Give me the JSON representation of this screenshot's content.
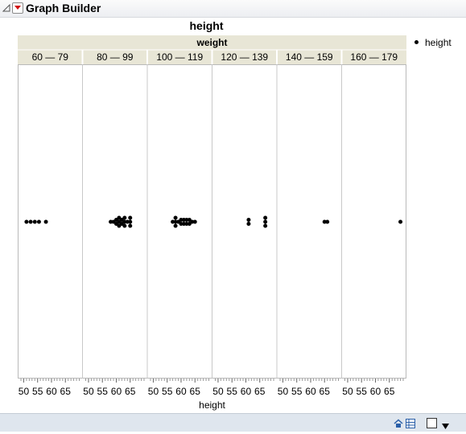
{
  "app": {
    "title": "Graph Builder"
  },
  "graph": {
    "title": "height",
    "legend": [
      {
        "label": "height",
        "marker": "filled-circle"
      }
    ]
  },
  "chart_data": {
    "type": "scatter",
    "title": "height",
    "xlabel": "height",
    "ylabel": "",
    "facet_title": "weight",
    "facets": [
      "60 — 79",
      "80 — 99",
      "100 — 119",
      "120 — 139",
      "140 — 159",
      "160 — 179"
    ],
    "xlim": [
      49,
      70
    ],
    "xticks": [
      50,
      55,
      60,
      65
    ],
    "grid": false,
    "legend_position": "right",
    "series": [
      {
        "name": "height",
        "panels": [
          {
            "x": [
              51,
              52.5,
              54,
              55.5,
              58
            ],
            "y": [
              0,
              0,
              0,
              0,
              0
            ]
          },
          {
            "x": [
              58,
              59,
              60,
              60,
              61,
              61,
              61,
              62,
              62,
              63,
              63,
              63,
              64,
              65,
              65,
              65
            ],
            "y": [
              0,
              0,
              0,
              0,
              0,
              0,
              0,
              0,
              0,
              0,
              0,
              0,
              0,
              0,
              0,
              0
            ]
          },
          {
            "x": [
              57,
              58,
              58,
              58,
              59,
              60,
              60,
              61,
              61,
              62,
              62,
              63,
              63,
              64,
              65
            ],
            "y": [
              0,
              0,
              0,
              0,
              0,
              0,
              0,
              0,
              0,
              0,
              0,
              0,
              0,
              0,
              0
            ]
          },
          {
            "x": [
              61,
              61,
              67,
              67,
              67
            ],
            "y": [
              0,
              0,
              0,
              0,
              0
            ]
          },
          {
            "x": [
              65,
              66
            ],
            "y": [
              0,
              0
            ]
          },
          {
            "x": [
              69
            ],
            "y": [
              0
            ]
          }
        ]
      }
    ]
  },
  "colors": {
    "header_bg": "#e8e6d6",
    "panel_border": "#c8c8c8",
    "status_bar": "#dfe6ee",
    "marker": "#000000",
    "menu_triangle": "#d01010"
  },
  "status": {
    "icons": [
      "home-icon",
      "table-icon",
      "checkbox-icon",
      "dropdown-arrow-icon"
    ]
  }
}
